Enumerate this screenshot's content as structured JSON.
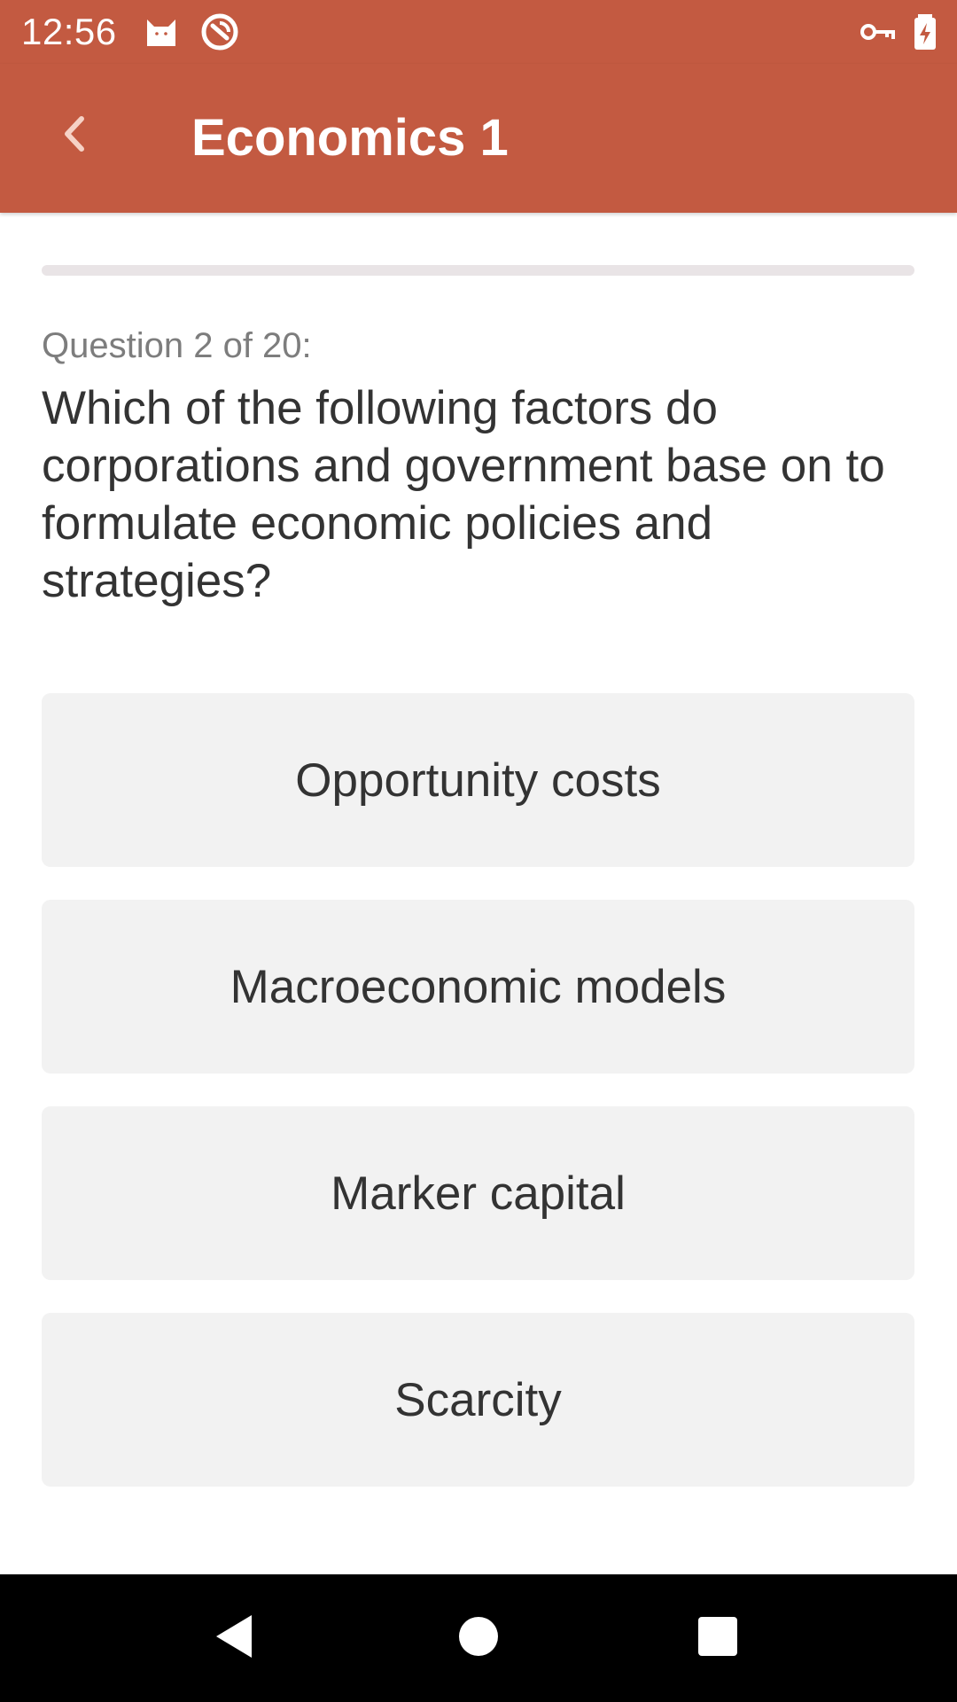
{
  "status_bar": {
    "time": "12:56",
    "icons": [
      "cat-icon",
      "sync-icon",
      "vpn-key-icon",
      "battery-charging-icon"
    ]
  },
  "app_bar": {
    "title": "Economics 1",
    "back_icon": "chevron-left-icon"
  },
  "progress": {
    "fraction": 0.0
  },
  "question": {
    "counter": "Question 2 of 20:",
    "text": "Which of the following factors do corporations and government base on to formulate economic policies and strategies?"
  },
  "answers": [
    {
      "label": "Opportunity costs"
    },
    {
      "label": "Macroeconomic models"
    },
    {
      "label": "Marker capital"
    },
    {
      "label": "Scarcity"
    }
  ],
  "nav_bar": {
    "icons": [
      "back-triangle-icon",
      "home-circle-icon",
      "recents-square-icon"
    ]
  },
  "colors": {
    "primary": "#C35A41",
    "answer_bg": "#F2F2F2",
    "text": "#333333",
    "muted_text": "#7D7D7D"
  }
}
